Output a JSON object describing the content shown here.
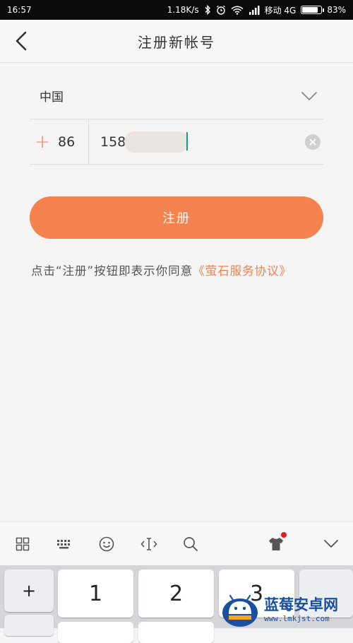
{
  "status_bar": {
    "time": "16:57",
    "net_speed": "1.18K/s",
    "carrier": "移动 4G",
    "battery_text": "83%",
    "battery_level": 0.83,
    "icons": [
      "bluetooth-icon",
      "alarm-icon",
      "wifi-icon",
      "signal-icon",
      "battery-icon"
    ]
  },
  "header": {
    "title": "注册新帐号",
    "back_icon": "chevron-left-icon"
  },
  "form": {
    "country": "中国",
    "country_code": "86",
    "phone_value": "158",
    "register_label": "注册"
  },
  "agreement": {
    "prefix": "点击“注册”按钮即表示你同意",
    "link": "《萤石服务协议》"
  },
  "keyboard": {
    "toolbar_icons": [
      "grid-icon",
      "keyboard-icon",
      "emoji-icon",
      "text-cursor-icon",
      "search-icon",
      "skin-icon",
      "collapse-icon"
    ],
    "side_key": "+",
    "keys": [
      "1",
      "2",
      "3"
    ]
  },
  "watermark": {
    "main": "蓝莓安卓网",
    "sub": "www.lmkjst.com"
  },
  "colors": {
    "accent": "#f4824e",
    "link": "#f18049",
    "cursor": "#1a9b8c"
  }
}
